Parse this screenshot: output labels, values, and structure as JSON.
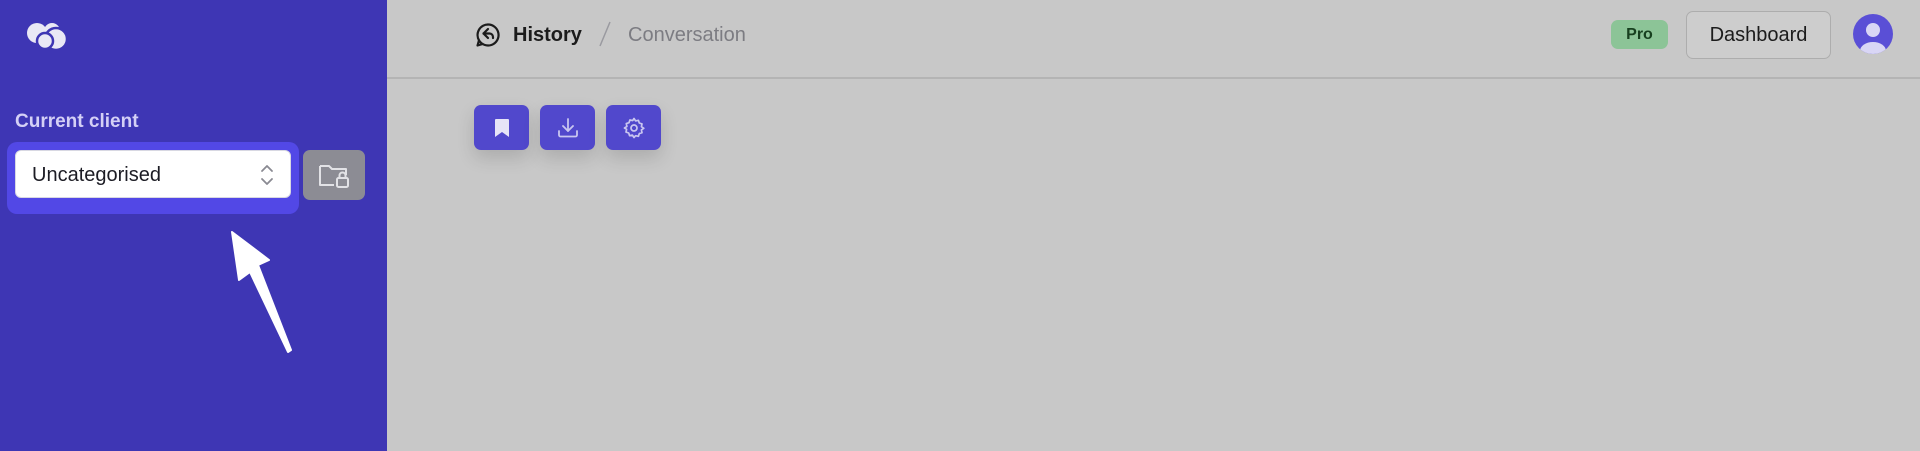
{
  "sidebar": {
    "logo_icon": "overlapping-circles-logo",
    "client_label": "Current client",
    "client_select": {
      "value": "Uncategorised",
      "icon": "chevron-up-down-icon"
    },
    "folder_button_icon": "folder-lock-icon"
  },
  "header": {
    "breadcrumb": {
      "icon": "history-chat-icon",
      "history": "History",
      "current": "Conversation"
    },
    "pro_badge": "Pro",
    "dashboard_label": "Dashboard",
    "avatar_icon": "user-avatar-icon"
  },
  "toolbar": {
    "buttons": [
      {
        "icon": "bookmark-icon"
      },
      {
        "icon": "download-icon"
      },
      {
        "icon": "gear-icon"
      }
    ]
  },
  "colors": {
    "sidebar_bg": "#3e36b4",
    "accent": "#5148cc",
    "main_bg": "#c8c8c8",
    "pro_badge": "#8cc497"
  }
}
